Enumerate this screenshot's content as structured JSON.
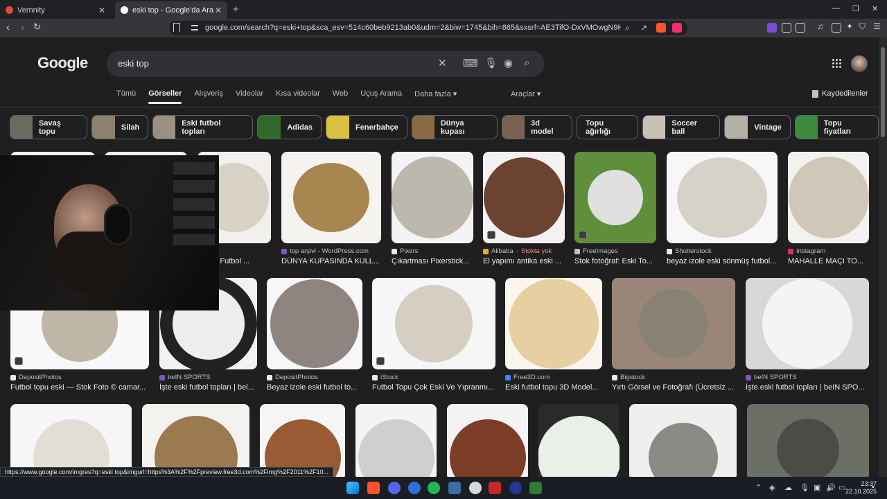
{
  "browser": {
    "tabs": [
      {
        "title": "Vernnity",
        "fav_color": "#e04a3a"
      },
      {
        "title": "eski top - Google'da Ara",
        "fav_color": "#ffffff"
      }
    ],
    "url": "google.com/search?q=eski+top&sca_esv=514c60beb9213ab0&udm=2&biw=1745&bih=865&sxsrf=AE3TifO-DxVMOwgN9HEwrCL32JDSVEIYK..."
  },
  "google": {
    "logo": "Google",
    "query": "eski top",
    "tabs": [
      "Tümü",
      "Görseller",
      "Alışveriş",
      "Videolar",
      "Kısa videolar",
      "Web",
      "Uçuş Arama",
      "Daha fazla ▾"
    ],
    "tools": "Araçlar ▾",
    "saved": "Kaydedilenler",
    "chips": [
      {
        "label": "Savaş topu",
        "color": "#6b6a5e"
      },
      {
        "label": "Silah",
        "color": "#8c8170"
      },
      {
        "label": "Eski futbol topları",
        "color": "#9a9081"
      },
      {
        "label": "Adidas",
        "color": "#2f6a2b"
      },
      {
        "label": "Fenerbahçe",
        "color": "#d8c040"
      },
      {
        "label": "Dünya kupası",
        "color": "#8a6a45"
      },
      {
        "label": "3d model",
        "color": "#7a6050"
      },
      {
        "label": "Topu ağırlığı",
        "color": ""
      },
      {
        "label": "Soccer ball",
        "color": "#c8c2b6"
      },
      {
        "label": "Vintage",
        "color": "#b5b0a5"
      },
      {
        "label": "Topu fiyatları",
        "color": "#3c8a3e"
      }
    ],
    "results": [
      {
        "source": "ock",
        "title": "Klasik Futbol ...",
        "bg": "#f2f0ec",
        "ball": "#d8d2c6"
      },
      {
        "source": "top arşivi - WordPress.com",
        "title": "DÜNYA KUPASINDA KULL...",
        "bg": "#f5f3ef",
        "ball": "#a88650"
      },
      {
        "source": "Pixers",
        "title": "Çıkartması Pixerstick...",
        "bg": "#f4f4f4",
        "ball": "#bdb8ad"
      },
      {
        "source": "Alibaba",
        "stock": "Stokta yok",
        "title": "El yapımı antika eski ...",
        "bg": "#f2f2f2",
        "ball": "#6b4330"
      },
      {
        "source": "FreeImages",
        "title": "Stok fotoğraf: Eski To...",
        "bg": "#5f8f3a",
        "ball": "#e0e0e0"
      },
      {
        "source": "Shutterstock",
        "title": "beyaz izole eski sönmüş futbol...",
        "bg": "#f7f7f7",
        "ball": "#d6d2c8"
      },
      {
        "source": "Instagram",
        "title": "MAHALLE MAÇI TO...",
        "bg": "#f4f2ee",
        "ball": "#cfc8b8"
      },
      {
        "source": "DepositPhotos",
        "title": "Futbol topu eski — Stok Foto © camar...",
        "bg": "#f8f8f8",
        "ball": "#bfb6a6"
      },
      {
        "source": "beIN SPORTS",
        "title": "İşte eski futbol topları | bel...",
        "bg": "#f2f2f2",
        "ball": "#eeeeee"
      },
      {
        "source": "DepositPhotos",
        "title": "Beyaz izole eski futbol to...",
        "bg": "#f7f7f7",
        "ball": "#8e8580"
      },
      {
        "source": "iStock",
        "title": "Futbol Topu Çok Eski Ve Yıpranmı...",
        "bg": "#f6f6f6",
        "ball": "#d4cfc2"
      },
      {
        "source": "Free3D.com",
        "title": "Eski futbol topu 3D Model...",
        "bg": "#faf6ee",
        "ball": "#e6cfa0"
      },
      {
        "source": "Bigstock",
        "title": "Yırtı Görsel ve Fotoğrafı (Ücretsiz ...",
        "bg": "#9a8678",
        "ball": "#8a8175"
      },
      {
        "source": "beIN SPORTS",
        "title": "İşte eski futbol topları | beIN SPO...",
        "bg": "#d8d8d8",
        "ball": "#f4f4f4"
      },
      {
        "bg": "#f6f6f6",
        "ball": "#e2ded6"
      },
      {
        "bg": "#f4f2ee",
        "ball": "#9b7a52"
      },
      {
        "bg": "#f5f5f5",
        "ball": "#9a5a33"
      },
      {
        "bg": "#f4f4f4",
        "ball": "#cfcfcf"
      },
      {
        "bg": "#f3f3f3",
        "ball": "#7e3d26"
      },
      {
        "bg": "#2a2a2a",
        "ball": "#e8f0e8"
      },
      {
        "bg": "#efefef",
        "ball": "#8b8a84"
      },
      {
        "bg": "#6b6f66",
        "ball": "#4a4c45"
      }
    ],
    "status_url": "https://www.google.com/imgres?q=eski top&imgurl=https%3A%2F%2Fpreview.free3d.com%2Fimg%2F2011%2F10..."
  },
  "taskbar": {
    "time": "23:37",
    "date": "22.10.2025"
  }
}
